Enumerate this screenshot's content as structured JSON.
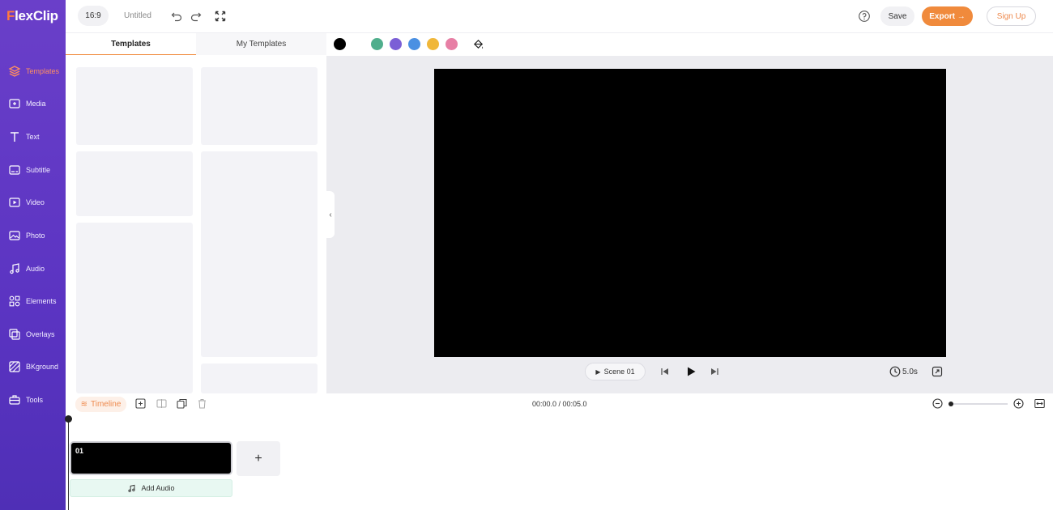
{
  "app": {
    "logo": "FlexClip",
    "logo_first": "F",
    "logo_rest": "lexClip"
  },
  "sidebar": {
    "items": [
      {
        "label": "Templates",
        "icon": "layers-icon",
        "active": true
      },
      {
        "label": "Media",
        "icon": "media-icon"
      },
      {
        "label": "Text",
        "icon": "text-icon"
      },
      {
        "label": "Subtitle",
        "icon": "subtitle-icon"
      },
      {
        "label": "Video",
        "icon": "video-icon"
      },
      {
        "label": "Photo",
        "icon": "photo-icon"
      },
      {
        "label": "Audio",
        "icon": "music-icon"
      },
      {
        "label": "Elements",
        "icon": "elements-icon"
      },
      {
        "label": "Overlays",
        "icon": "overlays-icon"
      },
      {
        "label": "BKground",
        "icon": "background-icon"
      },
      {
        "label": "Tools",
        "icon": "toolbox-icon"
      }
    ]
  },
  "topbar": {
    "ratio": "16:9",
    "title": "Untitled",
    "save": "Save",
    "export": "Export →",
    "signup": "Sign Up"
  },
  "panel": {
    "tabs": [
      {
        "label": "Templates",
        "active": true
      },
      {
        "label": "My Templates",
        "active": false
      }
    ]
  },
  "colors": {
    "accent": "#f08a3c",
    "sidebar": "#5b34c2",
    "swatches": [
      "#000000",
      "#ffffff",
      "#4fae8c",
      "#7b5fd6",
      "#4a90e2",
      "#f0b73a",
      "#e77fa5"
    ]
  },
  "player": {
    "scene": "Scene 01",
    "duration": "5.0s"
  },
  "timeline": {
    "label": "Timeline",
    "time": "00:00.0 / 00:05.0",
    "clip_number": "01",
    "add_audio": "Add Audio",
    "add_scene": "+",
    "zoom": 0.0
  }
}
